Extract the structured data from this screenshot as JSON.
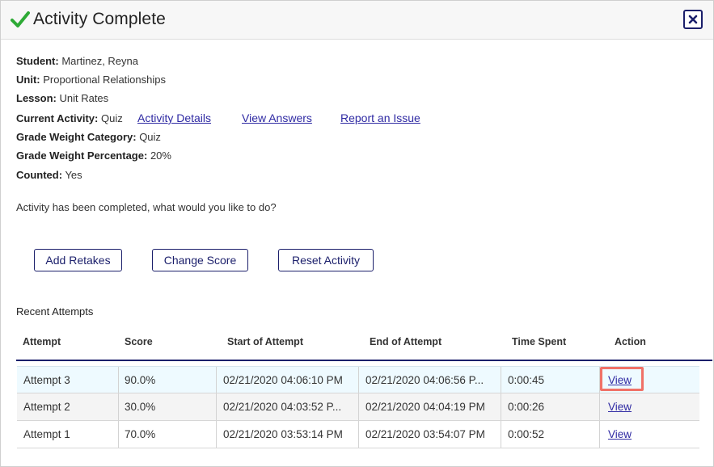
{
  "dialog": {
    "title": "Activity Complete",
    "close_icon": "close-icon",
    "check_icon": "check-icon"
  },
  "info": {
    "student_label": "Student:",
    "student": "Martinez, Reyna",
    "unit_label": "Unit:",
    "unit": "Proportional Relationships",
    "lesson_label": "Lesson:",
    "lesson": "Unit Rates",
    "activity_label": "Current Activity:",
    "activity": "Quiz",
    "category_label": "Grade Weight Category:",
    "category": "Quiz",
    "percentage_label": "Grade Weight Percentage:",
    "percentage": "20%",
    "counted_label": "Counted:",
    "counted": "Yes"
  },
  "links": {
    "details": "Activity Details",
    "answers": "View Answers",
    "issue": "Report an Issue"
  },
  "prompt": "Activity has been completed, what would you like to do?",
  "buttons": {
    "retakes": "Add Retakes",
    "change_score": "Change Score",
    "reset": "Reset Activity"
  },
  "attempts": {
    "title": "Recent Attempts",
    "headers": [
      "Attempt",
      "Score",
      "Start of Attempt",
      "End of Attempt",
      "Time Spent",
      "Action"
    ],
    "rows": [
      [
        "Attempt 3",
        "90.0%",
        "02/21/2020 04:06:10 PM",
        "02/21/2020 04:06:56 P...",
        "0:00:45",
        "View"
      ],
      [
        "Attempt 2",
        "30.0%",
        "02/21/2020 04:03:52 P...",
        "02/21/2020 04:04:19 PM",
        "0:00:26",
        "View"
      ],
      [
        "Attempt 1",
        "70.0%",
        "02/21/2020 03:53:14 PM",
        "02/21/2020 03:54:07 PM",
        "0:00:52",
        "View"
      ]
    ]
  },
  "colors": {
    "accent": "#1b1f6b",
    "link": "#2f2aa3",
    "check": "#2eaa36",
    "highlight": "#f07167",
    "selected_row": "#eefaff"
  }
}
